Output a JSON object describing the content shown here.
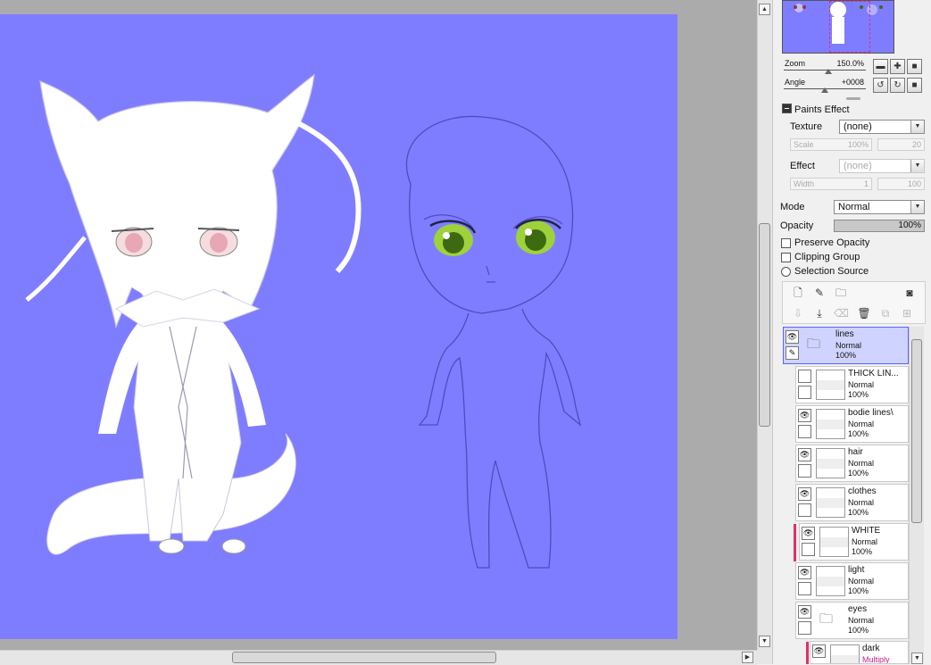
{
  "navigator": {
    "zoom_label": "Zoom",
    "zoom_value": "150.0%",
    "angle_label": "Angle",
    "angle_value": "+0008"
  },
  "paints_effect": {
    "title": "Paints Effect",
    "texture_label": "Texture",
    "texture_value": "(none)",
    "scale_label": "Scale",
    "scale_value": "100%",
    "scale_amount": "20",
    "effect_label": "Effect",
    "effect_value": "(none)",
    "width_label": "Width",
    "width_value": "1",
    "width_amount": "100"
  },
  "layer_props": {
    "mode_label": "Mode",
    "mode_value": "Normal",
    "opacity_label": "Opacity",
    "opacity_value": "100%",
    "preserve_opacity": "Preserve Opacity",
    "clipping_group": "Clipping Group",
    "selection_source": "Selection Source"
  },
  "layers": [
    {
      "name": "lines",
      "mode": "Normal",
      "opacity": "100%"
    },
    {
      "name": "THICK LIN...",
      "mode": "Normal",
      "opacity": "100%"
    },
    {
      "name": "bodie lines\\",
      "mode": "Normal",
      "opacity": "100%"
    },
    {
      "name": "hair",
      "mode": "Normal",
      "opacity": "100%"
    },
    {
      "name": "clothes",
      "mode": "Normal",
      "opacity": "100%"
    },
    {
      "name": "WHITE",
      "mode": "Normal",
      "opacity": "100%"
    },
    {
      "name": "light",
      "mode": "Normal",
      "opacity": "100%"
    },
    {
      "name": "eyes",
      "mode": "Normal",
      "opacity": "100%"
    },
    {
      "name": "dark",
      "mode": "Multiply",
      "opacity": ""
    }
  ],
  "colors": {
    "canvas_bg": "#7f7dff",
    "selected_layer": "#cfd3ff",
    "clip_marker": "#e0306a"
  }
}
